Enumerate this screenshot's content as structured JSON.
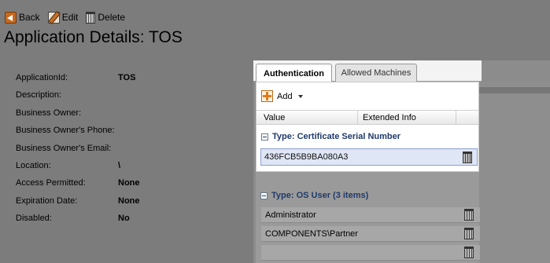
{
  "toolbar": {
    "back_label": "Back",
    "edit_label": "Edit",
    "delete_label": "Delete"
  },
  "page_title": "Application Details: TOS",
  "details": [
    {
      "label": "ApplicationId:",
      "value": "TOS"
    },
    {
      "label": "Description:",
      "value": ""
    },
    {
      "label": "Business Owner:",
      "value": ""
    },
    {
      "label": "Business Owner's Phone:",
      "value": ""
    },
    {
      "label": "Business Owner's Email:",
      "value": ""
    },
    {
      "label": "Location:",
      "value": "\\"
    },
    {
      "label": "Access Permitted:",
      "value": "None"
    },
    {
      "label": "Expiration Date:",
      "value": "None"
    },
    {
      "label": "Disabled:",
      "value": "No"
    }
  ],
  "tabs": {
    "authentication": "Authentication",
    "allowed_machines": "Allowed Machines"
  },
  "grid": {
    "add_label": "Add",
    "col_value": "Value",
    "col_extended_info": "Extended Info",
    "group_certificate": "Type: Certificate Serial Number",
    "certificate_value": "436FCB5B9BA080A3",
    "group_os_user": "Type: OS User (3 items)",
    "os_users": [
      "Administrator",
      "COMPONENTS\\Partner",
      ""
    ]
  },
  "icons": {
    "back": "back-arrow-icon",
    "edit": "edit-pencil-icon",
    "delete": "trash-icon",
    "add": "add-plus-icon",
    "collapse": "collapse-minus-icon"
  }
}
